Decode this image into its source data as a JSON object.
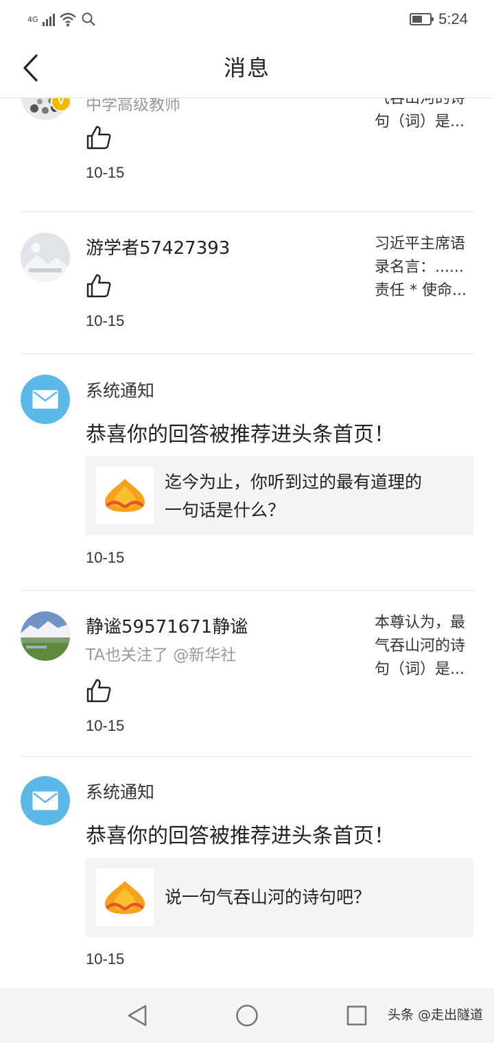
{
  "status_bar": {
    "network": "4G",
    "battery_level": 0.6,
    "time": "5:24",
    "icons": [
      "signal-icon",
      "wifi-icon",
      "search-icon",
      "battery-icon"
    ]
  },
  "header": {
    "back_icon": "chevron-left-icon",
    "title": "消息"
  },
  "messages": [
    {
      "subline": "中学高级教师",
      "snippet": [
        "气吞山河的诗",
        "句（词）是..."
      ],
      "date": "10-15",
      "verified": "V"
    },
    {
      "name": "游学者57427393",
      "snippet": [
        "习近平主席语",
        "录名言：......",
        "责任 * 使命..."
      ],
      "date": "10-15"
    },
    {
      "label": "系统通知",
      "title": "恭喜你的回答被推荐进头条首页！",
      "card_text": [
        "迄今为止，你听到过的最有道理的",
        "一句话是什么？"
      ],
      "date": "10-15"
    },
    {
      "name": "静谧59571671静谧",
      "subline": "TA也关注了 @新华社",
      "snippet": [
        "本尊认为，最",
        "气吞山河的诗",
        "句（词）是..."
      ],
      "date": "10-15"
    },
    {
      "label": "系统通知",
      "title": "恭喜你的回答被推荐进头条首页！",
      "card_text": [
        "说一句气吞山河的诗句吧？"
      ],
      "date": "10-15"
    }
  ],
  "navbar": {
    "icons": [
      "back-triangle-icon",
      "home-circle-icon",
      "recents-square-icon"
    ],
    "watermark": "头条 @走出隧道"
  },
  "colors": {
    "mail_avatar": "#5cb8e6",
    "verified_badge": "#f5b800",
    "card_bg": "#f3f4f6",
    "date_text": "#333333",
    "sub_text": "#999999"
  }
}
